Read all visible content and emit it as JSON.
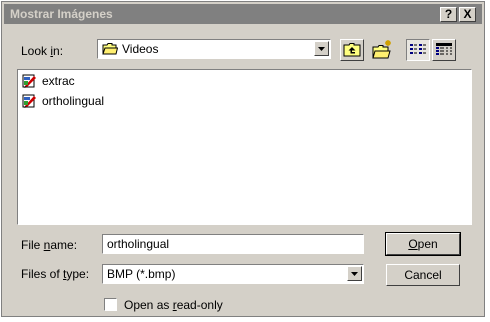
{
  "window": {
    "title": "Mostrar Imágenes",
    "help_button": "?",
    "close_button": "X"
  },
  "look_in": {
    "label_pre": "Look ",
    "label_key": "i",
    "label_post": "n:",
    "value": "Videos"
  },
  "toolbar": {
    "icons": [
      "up-one-level-icon",
      "new-folder-icon",
      "list-view-icon",
      "details-view-icon"
    ]
  },
  "files": [
    {
      "name": "extrac",
      "icon": "file-icon"
    },
    {
      "name": "ortholingual",
      "icon": "file-icon"
    }
  ],
  "file_name": {
    "label_pre": "File ",
    "label_key": "n",
    "label_post": "ame:",
    "value": "ortholingual"
  },
  "files_of_type": {
    "label_pre": "Files of ",
    "label_key": "t",
    "label_post": "ype:",
    "value": "BMP (*.bmp)"
  },
  "buttons": {
    "open_key": "O",
    "open_rest": "pen",
    "cancel": "Cancel"
  },
  "read_only": {
    "label_pre": "Open as ",
    "label_key": "r",
    "label_post": "ead-only",
    "checked": false
  }
}
